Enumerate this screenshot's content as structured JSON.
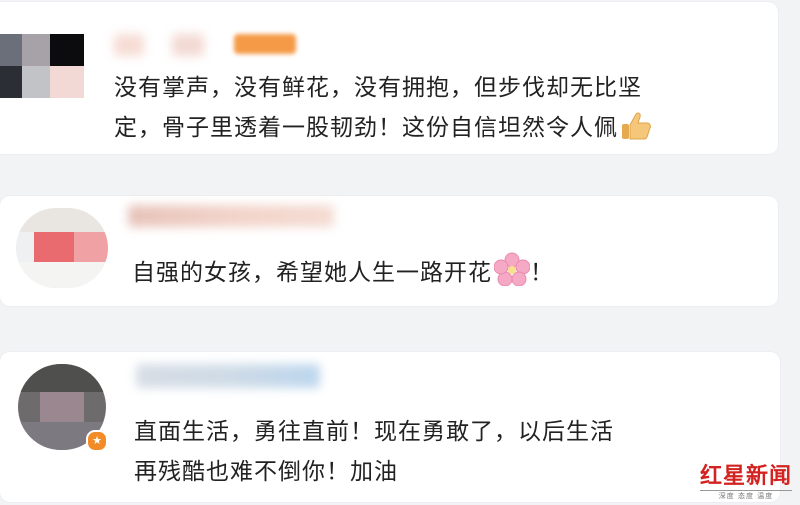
{
  "comments": [
    {
      "lines": [
        "没有掌声，没有鲜花，没有拥抱，但步伐却无比坚",
        "定，骨子里透着一股韧劲！这份自信坦然令人佩"
      ],
      "emoji": "thumbs-up-icon"
    },
    {
      "lines": [
        "自强的女孩，希望她人生一路开花"
      ],
      "suffix": "！",
      "emoji": "cherry-blossom-icon"
    },
    {
      "lines": [
        "直面生活，勇往直前！现在勇敢了，以后生活",
        "再残酷也难不倒你！加油"
      ]
    }
  ],
  "watermark": {
    "brand": "红星新闻",
    "sub": "深度 态度 温度",
    "color": "#d32320"
  }
}
